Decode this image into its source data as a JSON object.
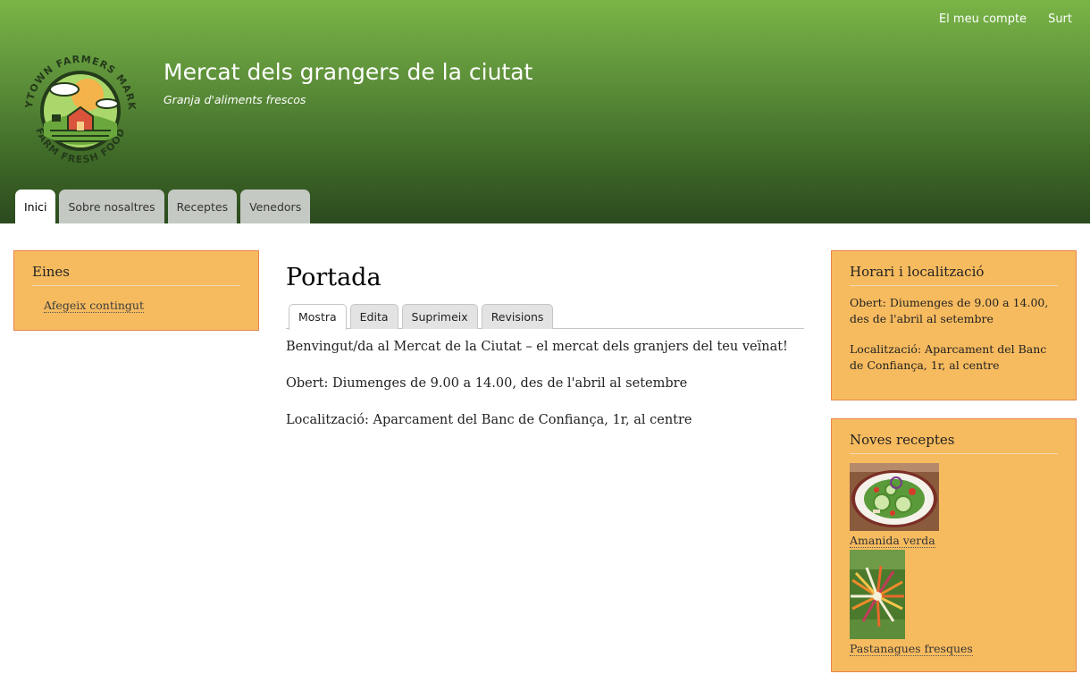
{
  "header": {
    "site_name": "Mercat dels grangers de la ciutat",
    "site_slogan": "Granja d'aliments  frescos",
    "logo_text_top": "ANYTOWN FARMERS MARKET",
    "logo_text_bottom": "FARM FRESH FOOD",
    "secondary_menu": [
      "El meu compte",
      "Surt"
    ],
    "main_menu": [
      {
        "label": "Inici",
        "active": true
      },
      {
        "label": "Sobre nosaltres",
        "active": false
      },
      {
        "label": "Receptes",
        "active": false
      },
      {
        "label": "Venedors",
        "active": false
      }
    ]
  },
  "sidebar_left": {
    "title": "Eines",
    "link": "Afegeix contingut"
  },
  "main": {
    "title": "Portada",
    "tabs": [
      {
        "label": "Mostra",
        "active": true
      },
      {
        "label": "Edita",
        "active": false
      },
      {
        "label": "Suprimeix",
        "active": false
      },
      {
        "label": "Revisions",
        "active": false
      }
    ],
    "paragraphs": [
      "Benvingut/da al Mercat de la Ciutat – el mercat dels granjers del teu veïnat!",
      "Obert: Diumenges de 9.00 a 14.00, des de l'abril al setembre",
      "Localització: Aparcament del Banc de Confiança, 1r, al centre"
    ]
  },
  "sidebar_right": {
    "hours": {
      "title": "Horari i localització",
      "open": "Obert: Diumenges de 9.00 a 14.00, des de l'abril al setembre",
      "location": "Localització: Aparcament del Banc de Confiança, 1r, al centre"
    },
    "recipes": {
      "title": "Noves receptes",
      "items": [
        {
          "label": "Amanida verda",
          "image": "salad-image"
        },
        {
          "label": "Pastanagues fresques",
          "image": "carrots-image"
        }
      ]
    }
  },
  "colors": {
    "header_top": "#7ab547",
    "header_bottom": "#2b4a1e",
    "block_bg": "#f7bb5f",
    "block_border": "#e5854b",
    "tab_inactive": "#c5c9c3"
  }
}
